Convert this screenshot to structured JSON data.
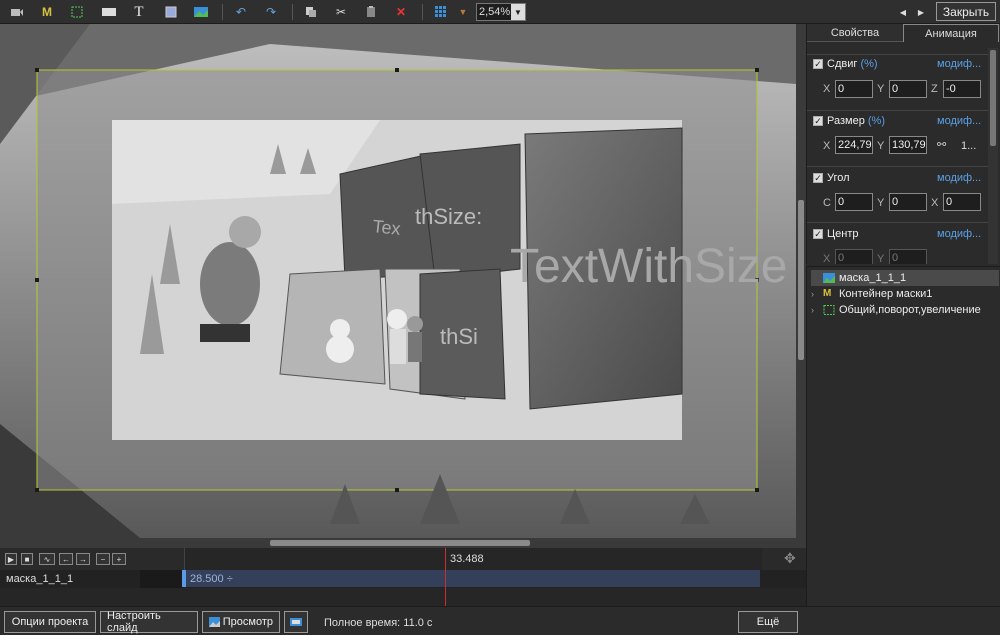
{
  "toolbar": {
    "zoom": "2,54%",
    "close_label": "Закрыть",
    "icons": [
      "video-icon",
      "mask-m-icon",
      "rect-select-icon",
      "ok-icon",
      "text-icon",
      "rectangle-icon",
      "image-icon",
      "undo-icon",
      "redo-icon",
      "copy-icon",
      "cut-icon",
      "paste-icon",
      "delete-icon",
      "grid-icon",
      "arrow-left-icon",
      "arrow-right-icon"
    ]
  },
  "canvas": {
    "big_text": "TextWithSize",
    "panel_text_1": "Tex",
    "panel_text_2": "thSize:",
    "panel_text_3": "thSi"
  },
  "props": {
    "tabs": [
      "Свойства",
      "Анимация"
    ],
    "active_tab": 1,
    "shift": {
      "label": "Сдвиг",
      "pct": "(%)",
      "mod": "модиф...",
      "x_label": "X",
      "x": "0",
      "y_label": "Y",
      "y": "0",
      "z_label": "Z",
      "z": "-0"
    },
    "size": {
      "label": "Размер",
      "pct": "(%)",
      "mod": "модиф...",
      "x_label": "X",
      "x": "224,79",
      "y_label": "Y",
      "y": "130,79",
      "extra": "1..."
    },
    "angle": {
      "label": "Угол",
      "mod": "модиф...",
      "c_label": "C",
      "c": "0",
      "y_label": "Y",
      "y": "0",
      "x_label": "X",
      "x": "0"
    },
    "center": {
      "label": "Центр",
      "mod": "модиф...",
      "x_label": "X",
      "x": "0",
      "y_label": "Y",
      "y": "0"
    }
  },
  "tree": [
    {
      "label": "маска_1_1_1",
      "selected": true,
      "icon": "image-icon"
    },
    {
      "label": "Контейнер маски1",
      "selected": false,
      "icon": "mask-m-icon"
    },
    {
      "label": "Общий,поворот,увеличение",
      "selected": false,
      "icon": "rect-select-icon"
    }
  ],
  "timeline": {
    "time_marker": "33.488",
    "track_name": "маска_1_1_1",
    "clip_label": "28.500 ÷",
    "buttons": [
      "play-icon",
      "stop-icon",
      "wave-icon",
      "prev-icon",
      "next-icon",
      "minus-icon",
      "plus-icon"
    ]
  },
  "bottom": {
    "project_options": "Опции проекта",
    "slide_settings": "Настроить слайд",
    "preview": "Просмотр",
    "total_time": "Полное время: 11.0 с",
    "more": "Ещё"
  },
  "colors": {
    "accent": "#5aa0e6",
    "selection": "#b9c832",
    "clip": "#34405a"
  }
}
